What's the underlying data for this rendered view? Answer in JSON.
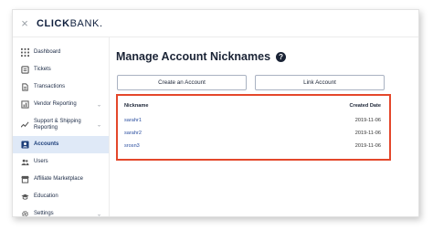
{
  "app": {
    "close_glyph": "×",
    "logo_bold": "CLICK",
    "logo_light": "BANK."
  },
  "sidebar": {
    "items": [
      {
        "label": "Dashboard",
        "icon": "grid-icon"
      },
      {
        "label": "Tickets",
        "icon": "ticket-icon"
      },
      {
        "label": "Transactions",
        "icon": "document-icon"
      },
      {
        "label": "Vendor Reporting",
        "icon": "chart-icon"
      },
      {
        "label": "Support & Shipping Reporting",
        "icon": "trend-icon"
      },
      {
        "label": "Accounts",
        "icon": "account-icon"
      },
      {
        "label": "Users",
        "icon": "users-icon"
      },
      {
        "label": "Affiliate Marketplace",
        "icon": "store-icon"
      },
      {
        "label": "Education",
        "icon": "graduation-icon"
      },
      {
        "label": "Settings",
        "icon": "gear-icon"
      }
    ]
  },
  "main": {
    "title": "Manage Account Nicknames",
    "help_glyph": "?",
    "create_button": "Create an Account",
    "link_button": "Link Account",
    "table": {
      "headers": {
        "nickname": "Nickname",
        "created": "Created Date"
      },
      "rows": [
        {
          "nickname": "sarahr1",
          "created": "2019-11-06"
        },
        {
          "nickname": "sarahr2",
          "created": "2019-11-06"
        },
        {
          "nickname": "srosn3",
          "created": "2019-11-06"
        }
      ]
    }
  },
  "colors": {
    "accent": "#1d3f7a",
    "highlight_border": "#e4472b",
    "active_bg": "#dfe9f7"
  }
}
